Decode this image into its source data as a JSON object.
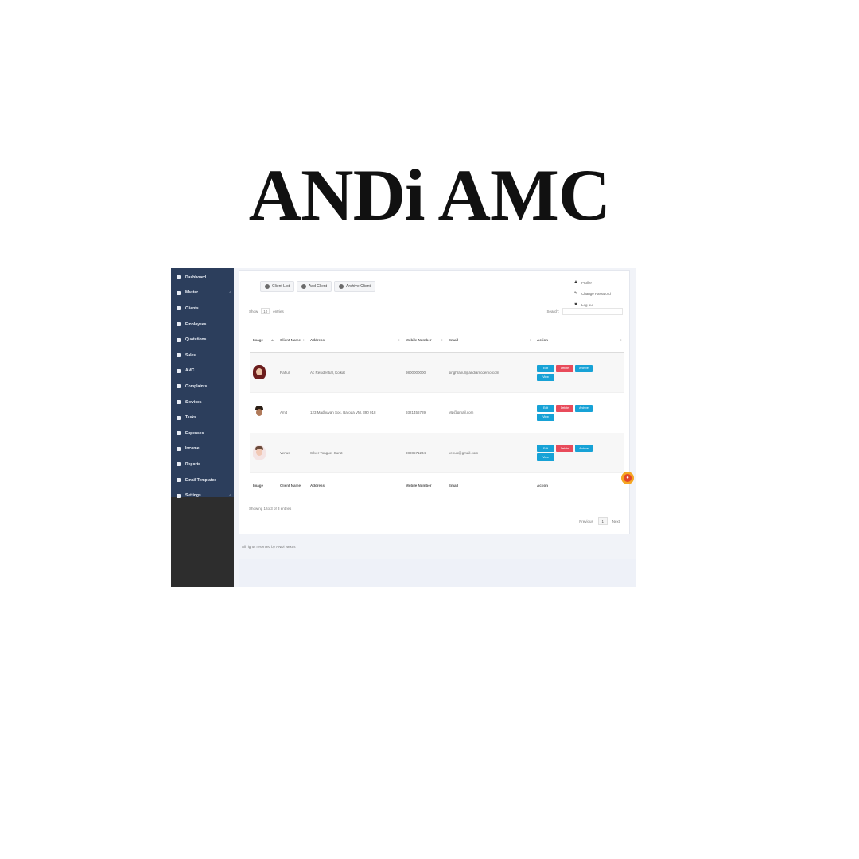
{
  "brand": {
    "title": "ANDi AMC"
  },
  "sidebar": {
    "items": [
      {
        "label": "Dashboard",
        "icon": "dashboard-icon",
        "has_caret": false
      },
      {
        "label": "Master",
        "icon": "master-icon",
        "has_caret": true
      },
      {
        "label": "Clients",
        "icon": "clients-icon",
        "has_caret": false
      },
      {
        "label": "Employees",
        "icon": "employees-icon",
        "has_caret": false
      },
      {
        "label": "Quotations",
        "icon": "quotations-icon",
        "has_caret": false
      },
      {
        "label": "Sales",
        "icon": "sales-icon",
        "has_caret": false
      },
      {
        "label": "AMC",
        "icon": "amc-icon",
        "has_caret": false
      },
      {
        "label": "Complaints",
        "icon": "complaints-icon",
        "has_caret": false
      },
      {
        "label": "Services",
        "icon": "services-icon",
        "has_caret": false
      },
      {
        "label": "Tasks",
        "icon": "tasks-icon",
        "has_caret": false
      },
      {
        "label": "Expenses",
        "icon": "expenses-icon",
        "has_caret": false
      },
      {
        "label": "Income",
        "icon": "income-icon",
        "has_caret": false
      },
      {
        "label": "Reports",
        "icon": "reports-icon",
        "has_caret": false
      },
      {
        "label": "Email Templates",
        "icon": "email-templates-icon",
        "has_caret": false
      },
      {
        "label": "Settings",
        "icon": "settings-icon",
        "has_caret": true
      }
    ]
  },
  "tabs": [
    {
      "label": "Client List",
      "icon": "list-icon"
    },
    {
      "label": "Add Client",
      "icon": "add-icon"
    },
    {
      "label": "Archive Client",
      "icon": "archive-icon"
    }
  ],
  "user_menu": {
    "items": [
      {
        "label": "Profile",
        "glyph": "♟"
      },
      {
        "label": "Change Password",
        "glyph": "✎"
      },
      {
        "label": "Log out",
        "glyph": "✖"
      }
    ]
  },
  "table_tools": {
    "show_label": "Show",
    "length_value": "10",
    "entries_label": "entries",
    "search_label": "Search:"
  },
  "table": {
    "columns": [
      "Image",
      "Client Name",
      "Address",
      "Mobile Number",
      "Email",
      "Action"
    ],
    "rows": [
      {
        "name": "Rahul",
        "address": "Ac Residential, Kolkat",
        "mobile": "9800000000",
        "email": "singhrahul@andiamcdemo.com"
      },
      {
        "name": "Amit",
        "address": "123 Madhuvan Soc, Baroda VM, 390 018",
        "mobile": "9321456789",
        "email": "Mp@gmail.com"
      },
      {
        "name": "Venus",
        "address": "Silver Tongue, Surat",
        "mobile": "9898571234",
        "email": "venus@gmail.com"
      }
    ],
    "action_labels": {
      "edit": "Edit",
      "delete": "Delete",
      "archive": "Archive",
      "view": "View"
    },
    "footer": [
      "Image",
      "Client Name",
      "Address",
      "Mobile Number",
      "Email",
      "Action"
    ]
  },
  "table_info": "Showing 1 to 3 of 3 entries",
  "pager": {
    "previous": "Previous",
    "current": "1",
    "next": "Next"
  },
  "footer_note": "All rights reserved by ANDi Nexus",
  "colors": {
    "sidebar_bg": "#2c3e5c",
    "info_button": "#17a2d6",
    "danger_button": "#e84b5b",
    "chat_badge": "#f5a623"
  }
}
